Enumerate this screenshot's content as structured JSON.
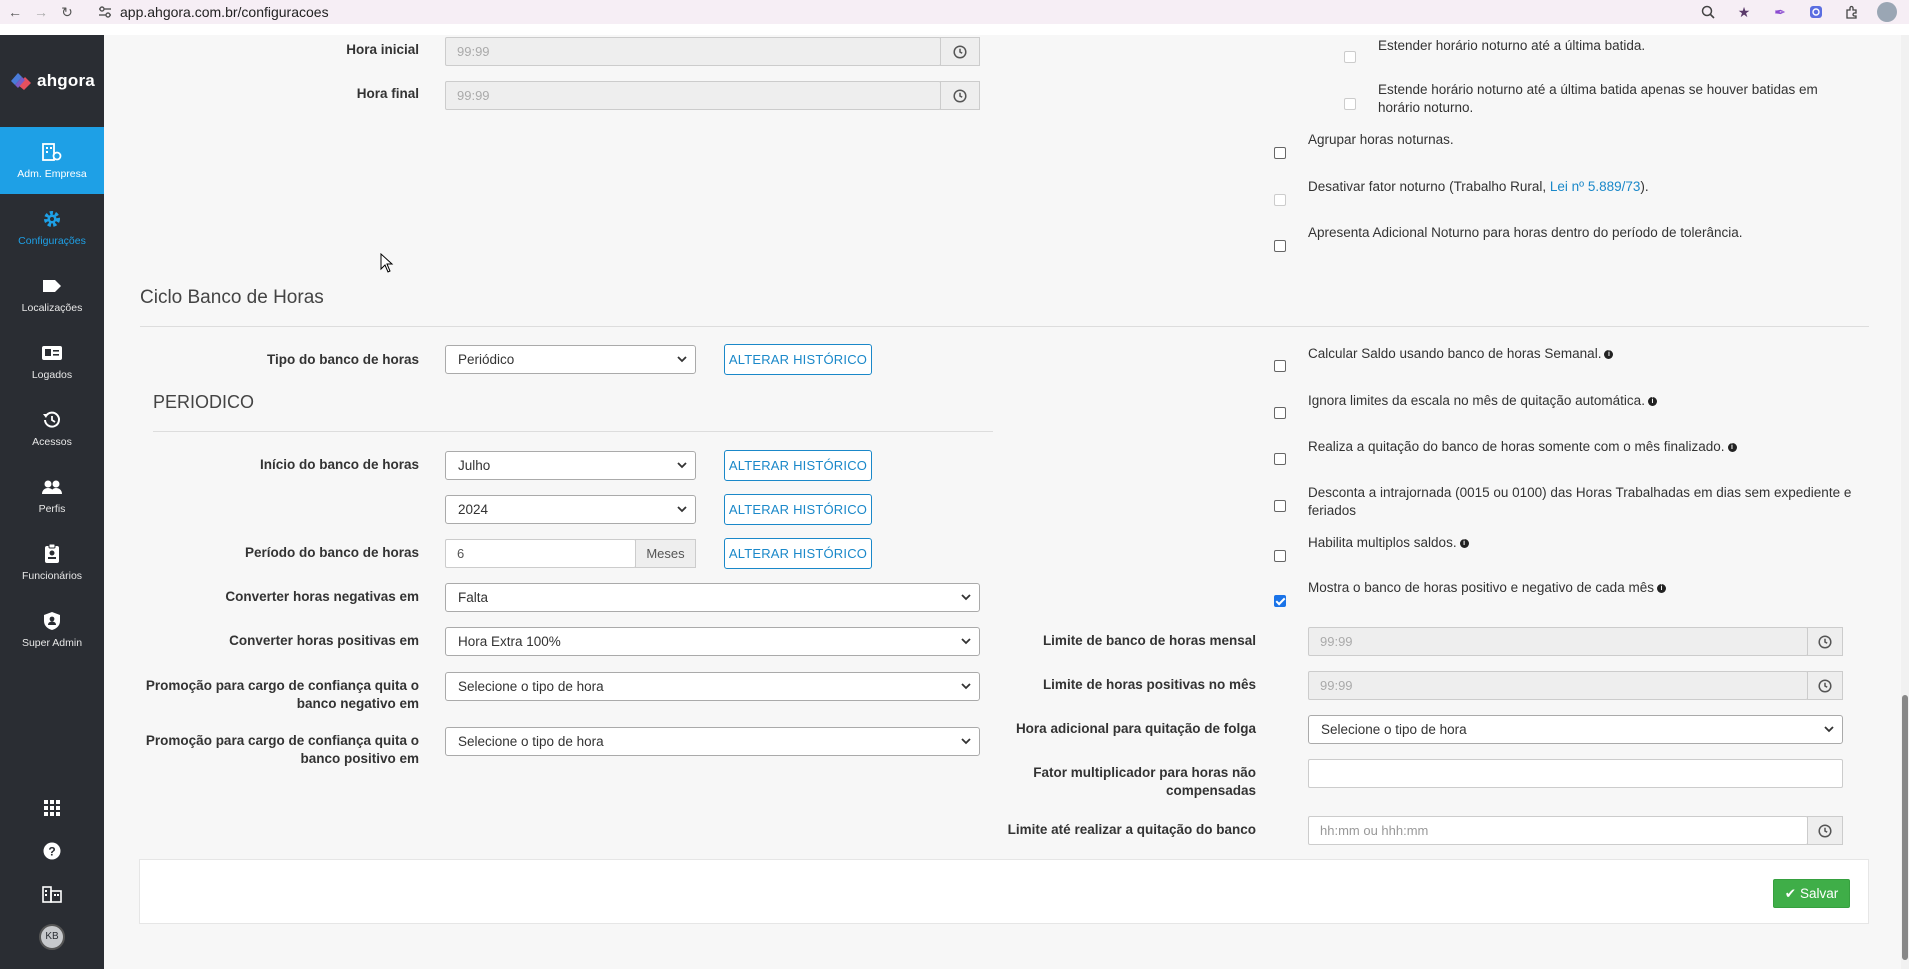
{
  "browser": {
    "url": "app.ahgora.com.br/configuracoes",
    "avatar_initial": "K"
  },
  "sidebar": {
    "logo_text": "ahgora",
    "items": [
      {
        "label": "Adm. Empresa",
        "icon": "building-gear-icon"
      },
      {
        "label": "Configurações",
        "icon": "gear-icon"
      },
      {
        "label": "Localizações",
        "icon": "tag-icon"
      },
      {
        "label": "Logados",
        "icon": "id-card-icon"
      },
      {
        "label": "Acessos",
        "icon": "history-icon"
      },
      {
        "label": "Perfis",
        "icon": "users-icon"
      },
      {
        "label": "Funcionários",
        "icon": "badge-icon"
      },
      {
        "label": "Super Admin",
        "icon": "shield-icon"
      }
    ],
    "user_initials": "KB"
  },
  "noturno": {
    "hora_inicial_label": "Hora inicial",
    "hora_inicial_value": "99:99",
    "hora_final_label": "Hora final",
    "hora_final_value": "99:99",
    "options": [
      {
        "text": "Estender horário noturno até a última batida.",
        "checked": false
      },
      {
        "text": "Estende horário noturno até a última batida apenas se houver batidas em horário noturno.",
        "checked": false
      },
      {
        "text": "Agrupar horas noturnas.",
        "checked": false
      },
      {
        "text_before": "Desativar fator noturno (Trabalho Rural, ",
        "link": "Lei nº 5.889/73",
        "text_after": ").",
        "checked": false
      },
      {
        "text": "Apresenta Adicional Noturno para horas dentro do período de tolerância.",
        "checked": false
      }
    ]
  },
  "ciclo": {
    "title": "Ciclo Banco de Horas",
    "tipo_label": "Tipo do banco de horas",
    "tipo_value": "Periódico",
    "alterar_label": "ALTERAR HISTÓRICO",
    "periodico_title": "PERIODICO",
    "inicio_label": "Início do banco de horas",
    "inicio_mes": "Julho",
    "inicio_ano": "2024",
    "periodo_label": "Período do banco de horas",
    "periodo_value": "6",
    "periodo_unit": "Meses",
    "conv_neg_label": "Converter horas negativas em",
    "conv_neg_value": "Falta",
    "conv_pos_label": "Converter horas positivas em",
    "conv_pos_value": "Hora Extra 100%",
    "promo_neg_label": "Promoção para cargo de confiança quita o banco negativo em",
    "promo_neg_value": "Selecione o tipo de hora",
    "promo_pos_label": "Promoção para cargo de confiança quita o banco positivo em",
    "promo_pos_value": "Selecione o tipo de hora",
    "right_options": [
      {
        "text": "Calcular Saldo usando banco de horas Semanal.",
        "checked": false
      },
      {
        "text": "Ignora limites da escala no mês de quitação automática.",
        "checked": false
      },
      {
        "text": "Realiza a quitação do banco de horas somente com o mês finalizado.",
        "checked": false
      },
      {
        "text": "Desconta a intrajornada (0015 ou 0100) das Horas Trabalhadas em dias sem expediente e feriados",
        "checked": false
      },
      {
        "text": "Habilita multiplos saldos.",
        "checked": false
      },
      {
        "text": "Mostra o banco de horas positivo e negativo de cada mês",
        "checked": true
      }
    ],
    "limite_mensal_label": "Limite de banco de horas mensal",
    "limite_mensal_value": "99:99",
    "limite_pos_label": "Limite de horas positivas no mês",
    "limite_pos_value": "99:99",
    "hora_adic_label": "Hora adicional para quitação de folga",
    "hora_adic_value": "Selecione o tipo de hora",
    "fator_label": "Fator multiplicador para horas não compensadas",
    "fator_value": "",
    "limite_quit_label": "Limite até realizar a quitação do banco",
    "limite_quit_placeholder": "hh:mm ou hhh:mm"
  },
  "footer": {
    "save_label": "Salvar"
  }
}
